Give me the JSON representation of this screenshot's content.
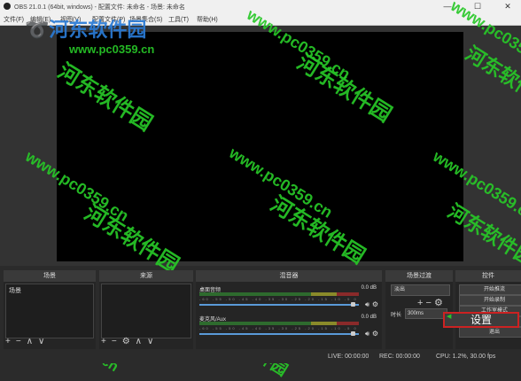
{
  "window": {
    "title": "OBS 21.0.1 (64bit, windows) - 配置文件: 未命名 - 场景: 未命名",
    "minimize": "—",
    "maximize": "☐",
    "close": "✕"
  },
  "menu": [
    "文件(F)",
    "编辑(E)",
    "视图(V)",
    "配置文件(P)",
    "场景集合(S)",
    "工具(T)",
    "帮助(H)"
  ],
  "docks": {
    "scenes": {
      "title": "场景",
      "item": "场景"
    },
    "sources": {
      "title": "来源"
    },
    "mixer": {
      "title": "混音器",
      "channels": [
        {
          "name": "桌面音频",
          "level": "0.0 dB"
        },
        {
          "name": "麦克风/Aux",
          "level": "0.0 dB"
        }
      ]
    },
    "transitions": {
      "title": "场景过渡",
      "selected": "淡出",
      "duration_label": "时长",
      "duration_value": "300ms"
    },
    "controls": {
      "title": "控件",
      "buttons": [
        "开始推流",
        "开始录制",
        "工作室模式",
        "设置",
        "退出"
      ],
      "highlight_text": "设置"
    }
  },
  "statusbar": {
    "live": "LIVE: 00:00:00",
    "rec": "REC: 00:00:00",
    "cpu": "CPU: 1.2%, 30.00 fps"
  },
  "watermarks": [
    {
      "text": "河东软件园",
      "x": 30,
      "y": 3
    },
    {
      "text": "www.pc0359.cn",
      "x": 55,
      "y": 26
    }
  ],
  "colors": {
    "accent": "#cc2222",
    "watermark": "#28c828"
  }
}
